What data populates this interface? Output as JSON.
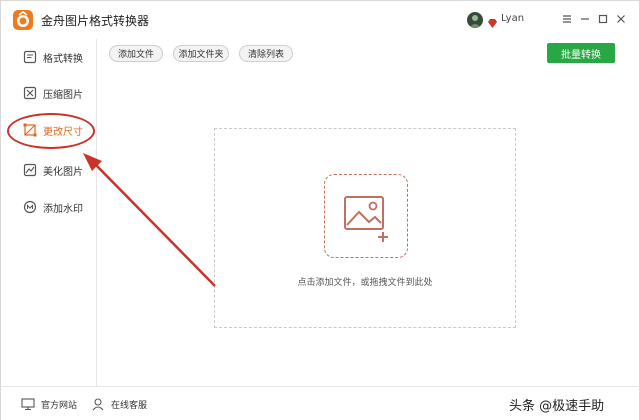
{
  "app": {
    "title": "金舟图片格式转换器",
    "user_name": "Lyan"
  },
  "colors": {
    "accent": "#e0681c",
    "batch_button": "#28a745",
    "annotation": "#c8342b"
  },
  "sidebar": {
    "items": [
      {
        "label": "格式转换",
        "icon": "format-convert-icon"
      },
      {
        "label": "压缩图片",
        "icon": "compress-icon"
      },
      {
        "label": "更改尺寸",
        "icon": "resize-icon",
        "active": true
      },
      {
        "label": "美化图片",
        "icon": "beautify-icon"
      },
      {
        "label": "添加水印",
        "icon": "watermark-icon"
      }
    ]
  },
  "toolbar": {
    "add_file": "添加文件",
    "add_folder": "添加文件夹",
    "clear_list": "清除列表",
    "batch_convert": "批量转换"
  },
  "dropzone": {
    "hint": "点击添加文件，或拖拽文件到此处"
  },
  "footer": {
    "official_site": "官方网站",
    "online_service": "在线客服",
    "watermark": "头条 @极速手助"
  }
}
